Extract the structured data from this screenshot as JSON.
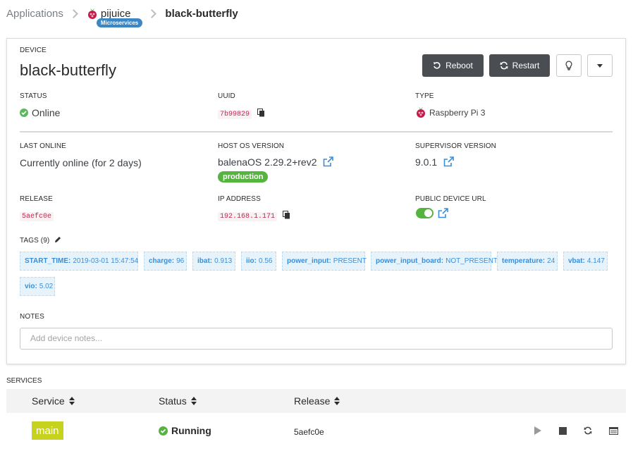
{
  "breadcrumb": {
    "root": "Applications",
    "app_name": "pijuice",
    "app_badge": "Microservices",
    "current": "black-butterfly"
  },
  "device": {
    "section_label": "DEVICE",
    "name": "black-butterfly",
    "actions": {
      "reboot": "Reboot",
      "restart": "Restart"
    },
    "status_label": "STATUS",
    "status": "Online",
    "uuid_label": "UUID",
    "uuid": "7b99829",
    "type_label": "TYPE",
    "type": "Raspberry Pi 3",
    "last_online_label": "LAST ONLINE",
    "last_online": "Currently online (for 2 days)",
    "host_os_label": "HOST OS VERSION",
    "host_os": "balenaOS 2.29.2+rev2",
    "host_os_badge": "production",
    "supervisor_label": "SUPERVISOR VERSION",
    "supervisor": "9.0.1",
    "release_label": "RELEASE",
    "release": "5aefc0e",
    "ip_label": "IP ADDRESS",
    "ip": "192.168.1.171",
    "public_url_label": "PUBLIC DEVICE URL",
    "public_url_enabled": true,
    "tags_label": "TAGS (9)",
    "tags": [
      {
        "key": "START_TIME:",
        "value": "2019-03-01 15:47:54"
      },
      {
        "key": "charge:",
        "value": "96"
      },
      {
        "key": "ibat:",
        "value": "0.913"
      },
      {
        "key": "iio:",
        "value": "0.56"
      },
      {
        "key": "power_input:",
        "value": "PRESENT"
      },
      {
        "key": "power_input_board:",
        "value": "NOT_PRESENT"
      },
      {
        "key": "temperature:",
        "value": "24"
      },
      {
        "key": "vbat:",
        "value": "4.147"
      },
      {
        "key": "vio:",
        "value": "5.02"
      }
    ],
    "notes_label": "NOTES",
    "notes_placeholder": "Add device notes..."
  },
  "services": {
    "section_label": "SERVICES",
    "columns": [
      "Service",
      "Status",
      "Release"
    ],
    "rows": [
      {
        "service": "main",
        "status": "Running",
        "release": "5aefc0e"
      }
    ]
  },
  "colors": {
    "online": "#5cb85c",
    "production_badge": "#55b43e",
    "service_badge": "#c6d21e",
    "microservices_badge": "#3b86c5",
    "tag_text": "#3a8ed8"
  }
}
